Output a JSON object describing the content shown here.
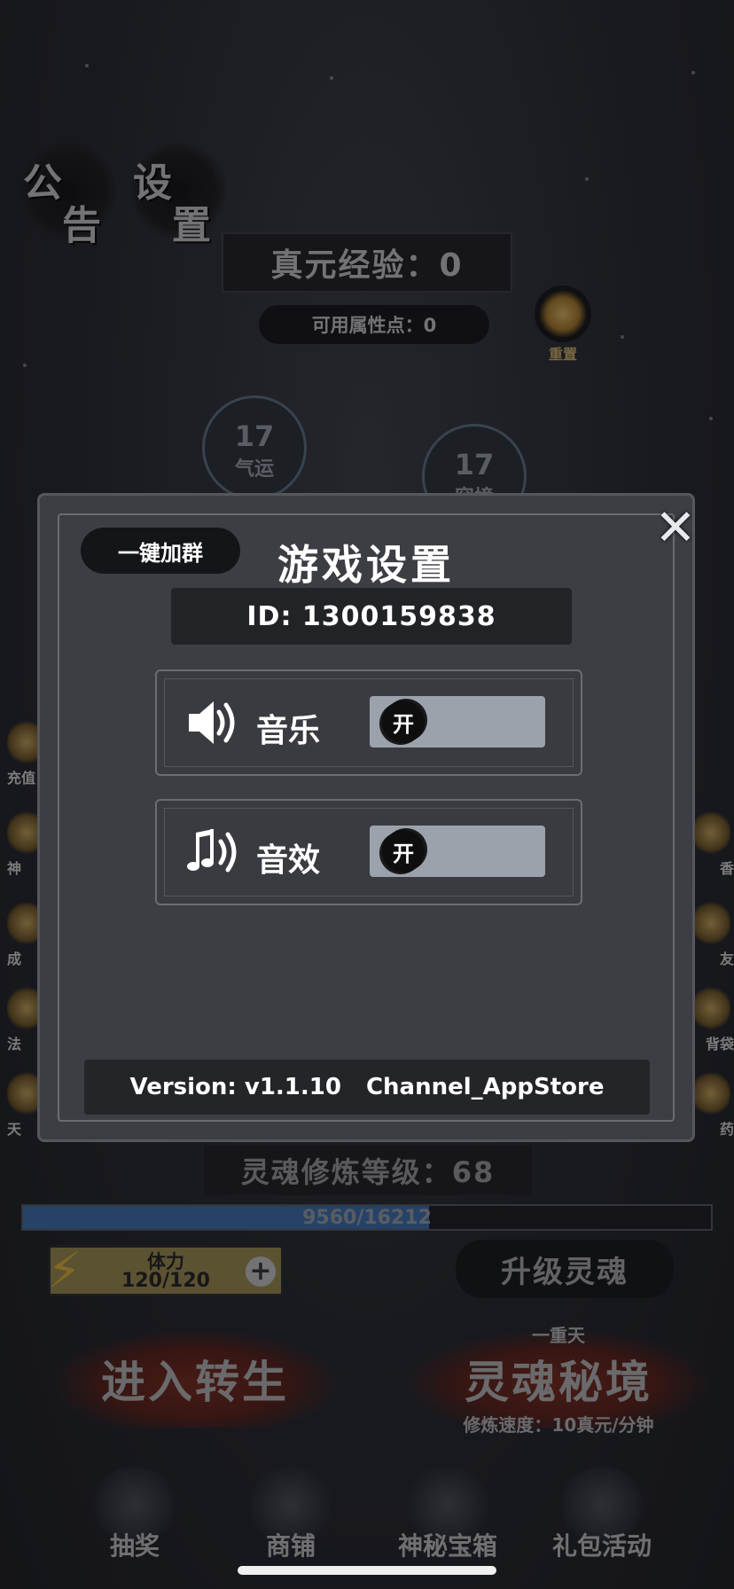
{
  "top_buttons": {
    "notice": {
      "char1": "公",
      "char2": "告"
    },
    "settings": {
      "char1": "设",
      "char2": "置"
    }
  },
  "true_essence_exp": "真元经验：0",
  "available_points": "可用属性点：0",
  "reset_label": "重置",
  "stats": [
    {
      "value": "17",
      "name": "气运"
    },
    {
      "value": "17",
      "name": "容境"
    }
  ],
  "side_left_labels": [
    "充值",
    "神",
    "成",
    "法",
    "天"
  ],
  "side_right_labels": [
    "香",
    "友",
    "背袋",
    "药"
  ],
  "soul_level": "灵魂修炼等级：68",
  "soul_progress": {
    "text": "9560/16212",
    "current": 9560,
    "max": 16212
  },
  "stamina": {
    "label": "体力",
    "value": "120/120",
    "plus": "+"
  },
  "upgrade_soul": "升级灵魂",
  "enter_rebirth": "进入转生",
  "soul_realm": {
    "top": "一重天",
    "title": "灵魂秘境",
    "sub": "修炼速度：10真元/分钟"
  },
  "bottom_nav": [
    "抽奖",
    "商铺",
    "神秘宝箱",
    "礼包活动"
  ],
  "modal": {
    "title": "游戏设置",
    "join_group": "一键加群",
    "close": "✕",
    "id_text": "ID:  1300159838",
    "music": {
      "label": "音乐",
      "state": "开"
    },
    "sfx": {
      "label": "音效",
      "state": "开"
    },
    "version": "Version: v1.1.10",
    "channel": "Channel_AppStore"
  },
  "colors": {
    "modal_bg": "#3d3e44",
    "toggle_track": "#9ba2ab",
    "progress_fill": "#3f6fb0",
    "stamina_bg": "#9d8d4d"
  }
}
